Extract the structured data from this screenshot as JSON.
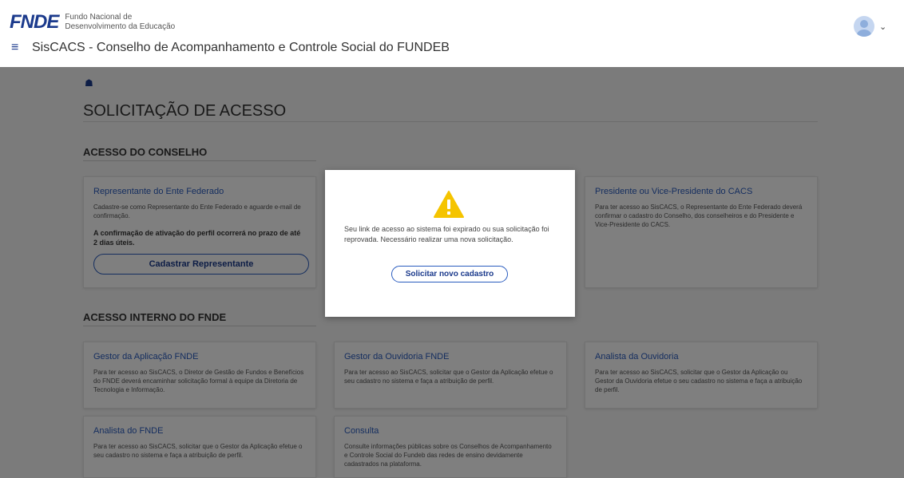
{
  "header": {
    "logo_mark": "FNDE",
    "logo_line1": "Fundo Nacional de",
    "logo_line2": "Desenvolvimento da Educação",
    "app_title": "SisCACS - Conselho de Acompanhamento e Controle Social do FUNDEB",
    "menu_icon": "≡",
    "user_chevron": "⌄"
  },
  "page": {
    "home_icon": "☗",
    "title": "SOLICITAÇÃO DE ACESSO"
  },
  "sections": {
    "conselho": {
      "title": "ACESSO DO CONSELHO",
      "cards": [
        {
          "title": "Representante do Ente Federado",
          "text": "Cadastre-se como Representante do Ente Federado e aguarde e-mail de confirmação.",
          "bold": "A confirmação de ativação do perfil ocorrerá no prazo de até 2 dias úteis.",
          "button": "Cadastrar Representante"
        },
        {
          "title": "Presidente ou Vice-Presidente do CACS",
          "text": "Para ter acesso ao SisCACS, o Representante do Ente Federado deverá confirmar o cadastro do Conselho, dos conselheiros e do Presidente e Vice-Presidente do CACS."
        }
      ]
    },
    "interno": {
      "title": "ACESSO INTERNO DO FNDE",
      "cards": [
        {
          "title": "Gestor da Aplicação FNDE",
          "text": "Para ter acesso ao SisCACS, o Diretor de Gestão de Fundos e Benefícios do FNDE deverá encaminhar solicitação formal à equipe da Diretoria de Tecnologia e Informação."
        },
        {
          "title": "Gestor da Ouvidoria FNDE",
          "text": "Para ter acesso ao SisCACS, solicitar que o Gestor da Aplicação efetue o seu cadastro no sistema e faça a atribuição de perfil."
        },
        {
          "title": "Analista da Ouvidoria",
          "text": "Para ter acesso ao SisCACS, solicitar que o Gestor da Aplicação ou Gestor da Ouvidoria efetue o seu cadastro no sistema e faça a atribuição de perfil."
        },
        {
          "title": "Analista do FNDE",
          "text": "Para ter acesso ao SisCACS, solicitar que o Gestor da Aplicação efetue o seu cadastro no sistema e faça a atribuição de perfil."
        },
        {
          "title": "Consulta",
          "text": "Consulte informações públicas sobre os Conselhos de Acompanhamento e Controle Social do Fundeb das redes de ensino devidamente cadastrados na plataforma."
        }
      ]
    }
  },
  "modal": {
    "icon": "warning-icon",
    "message": "Seu link de acesso ao sistema foi expirado ou sua solicitação foi reprovada. Necessário realizar uma nova solicitação.",
    "button": "Solicitar novo cadastro",
    "warning_color": "#f5c400"
  }
}
